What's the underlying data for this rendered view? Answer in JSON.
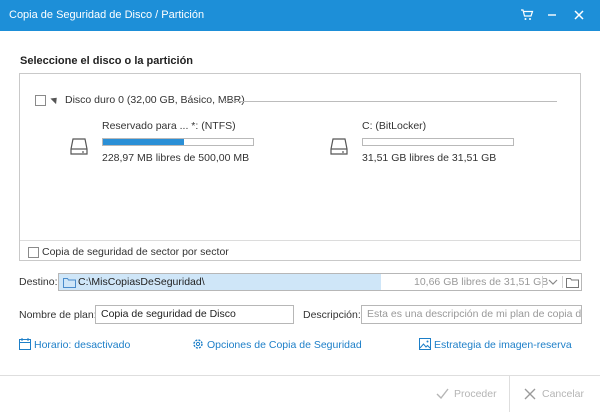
{
  "window": {
    "title": "Copia de Seguridad de Disco / Partición"
  },
  "section_title": "Seleccione el disco o la partición",
  "disk": {
    "label": "Disco duro 0 (32,00 GB, Básico, MBR)",
    "partitions": [
      {
        "name": "Reservado para ... *: (NTFS)",
        "free": "228,97 MB libres de 500,00 MB",
        "used_fraction": 0.54
      },
      {
        "name": "C: (BitLocker)",
        "free": "31,51 GB libres de 31,51 GB",
        "used_fraction": 0.0
      }
    ]
  },
  "sector_by_sector_label": "Copia de seguridad de sector por sector",
  "destination": {
    "label": "Destino:",
    "path": "C:\\MisCopiasDeSeguridad\\",
    "free": "10,66 GB libres de 31,51 GB"
  },
  "plan": {
    "label": "Nombre de plan:",
    "value": "Copia de seguridad de Disco"
  },
  "description": {
    "label": "Descripción:",
    "placeholder": "Esta es una descripción de mi plan de copia de seguridad"
  },
  "links": {
    "schedule": "Horario: desactivado",
    "options": "Opciones de Copia de Seguridad",
    "strategy": "Estrategia de imagen-reserva"
  },
  "buttons": {
    "proceed": "Proceder",
    "cancel": "Cancelar"
  },
  "colors": {
    "titlebar": "#1d8fd8",
    "accent": "#1d7fc8",
    "bar_fill": "#2a8fd6",
    "selection": "#cfe6f8"
  }
}
